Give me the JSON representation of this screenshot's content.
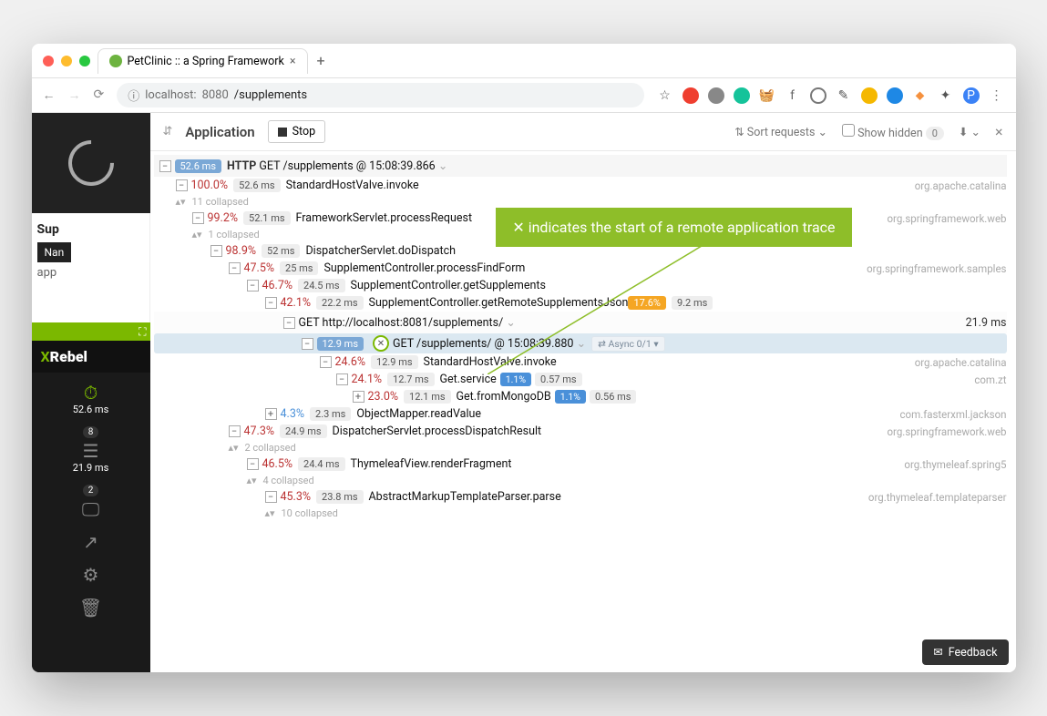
{
  "browser": {
    "tab_title": "PetClinic :: a Spring Framework",
    "url_host": "localhost:",
    "url_port": "8080",
    "url_path": "/supplements",
    "profile_letter": "P"
  },
  "traffic_colors": {
    "red": "#ff5f57",
    "yellow": "#febc2e",
    "green": "#28c840"
  },
  "sidebar": {
    "sup_title": "Sup",
    "name_btn": "Nan",
    "app_text": "app",
    "xrebel_logo_pre": "X",
    "xrebel_logo": "Rebel",
    "stat1": "52.6 ms",
    "stat2_badge": "8",
    "stat2": "21.9 ms",
    "stat3_badge": "2"
  },
  "toolbar": {
    "app_label": "Application",
    "stop_label": "Stop",
    "sort_label": "Sort requests",
    "show_hidden_label": "Show hidden",
    "hidden_count": "0"
  },
  "callout": {
    "text": "✕ indicates the start of a remote application trace"
  },
  "feedback_label": "Feedback",
  "tree": {
    "r0_ms": "52.6 ms",
    "r0_proto": "HTTP",
    "r0_method": "GET /supplements @ 15:08:39.866",
    "r1_pct": "100.0%",
    "r1_ms": "52.6 ms",
    "r1_method": "StandardHostValve.invoke",
    "r1_pkg": "org.apache.catalina",
    "r1_note": "11 collapsed",
    "r2_pct": "99.2%",
    "r2_ms": "52.1 ms",
    "r2_method": "FrameworkServlet.processRequest",
    "r2_pkg": "org.springframework.web",
    "r2_note": "1 collapsed",
    "r3_pct": "98.9%",
    "r3_ms": "52 ms",
    "r3_method": "DispatcherServlet.doDispatch",
    "r4_pct": "47.5%",
    "r4_ms": "25 ms",
    "r4_method": "SupplementController.processFindForm",
    "r4_pkg": "org.springframework.samples",
    "r5_pct": "46.7%",
    "r5_ms": "24.5 ms",
    "r5_method": "SupplementController.getSupplements",
    "r6_pct": "42.1%",
    "r6_ms": "22.2 ms",
    "r6_method": "SupplementController.getRemoteSupplementsJson",
    "r6_badge": "17.6%",
    "r6_ms2": "9.2 ms",
    "r7_method": "GET http://localhost:8081/supplements/",
    "r7_ms": "21.9 ms",
    "r8_ms": "12.9 ms",
    "r8_method": "GET /supplements/ @ 15:08:39.880",
    "r8_async": "⇄ Async 0/1 ▾",
    "r9_pct": "24.6%",
    "r9_ms": "12.9 ms",
    "r9_method": "StandardHostValve.invoke",
    "r9_pkg": "org.apache.catalina",
    "r10_pct": "24.1%",
    "r10_ms": "12.7 ms",
    "r10_method": "Get.service",
    "r10_badge": "1.1%",
    "r10_ms2": "0.57 ms",
    "r10_pkg": "com.zt",
    "r11_pct": "23.0%",
    "r11_ms": "12.1 ms",
    "r11_method": "Get.fromMongoDB",
    "r11_badge": "1.1%",
    "r11_ms2": "0.56 ms",
    "r12_pct": "4.3%",
    "r12_ms": "2.3 ms",
    "r12_method": "ObjectMapper.readValue",
    "r12_pkg": "com.fasterxml.jackson",
    "r13_pct": "47.3%",
    "r13_ms": "24.9 ms",
    "r13_method": "DispatcherServlet.processDispatchResult",
    "r13_pkg": "org.springframework.web",
    "r13_note": "2 collapsed",
    "r14_pct": "46.5%",
    "r14_ms": "24.4 ms",
    "r14_method": "ThymeleafView.renderFragment",
    "r14_pkg": "org.thymeleaf.spring5",
    "r14_note": "4 collapsed",
    "r15_pct": "45.3%",
    "r15_ms": "23.8 ms",
    "r15_method": "AbstractMarkupTemplateParser.parse",
    "r15_pkg": "org.thymeleaf.templateparser",
    "r15_note": "10 collapsed"
  }
}
